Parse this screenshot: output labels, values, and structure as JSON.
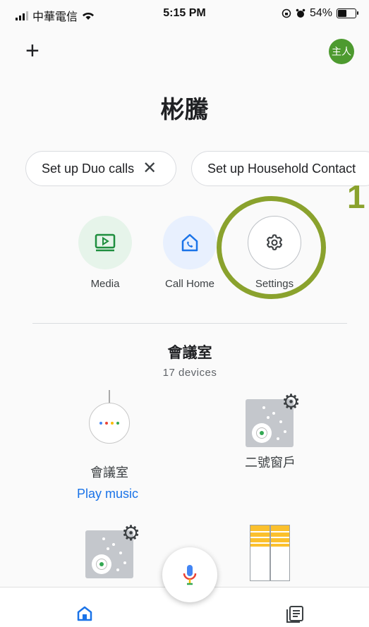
{
  "status_bar": {
    "carrier": "中華電信",
    "time": "5:15 PM",
    "battery_percent": "54%",
    "battery_level": 0.54,
    "icons": [
      "signal-icon",
      "wifi-icon",
      "rotation-lock-icon",
      "alarm-icon",
      "battery-icon"
    ]
  },
  "header": {
    "add_icon": "plus-icon",
    "avatar_text": "主人",
    "avatar_color": "#4d9a2f"
  },
  "home": {
    "name": "彬騰"
  },
  "chips": {
    "duo": {
      "label": "Set up Duo calls",
      "close_icon": "close-icon"
    },
    "household": {
      "label": "Set up Household Contact"
    }
  },
  "actions": [
    {
      "label": "Media",
      "icon": "media-icon"
    },
    {
      "label": "Call Home",
      "icon": "call-home-icon"
    },
    {
      "label": "Settings",
      "icon": "gear-icon"
    }
  ],
  "annotation": {
    "number": "1",
    "color": "#8aa22d"
  },
  "room": {
    "name": "會議室",
    "device_count": "17 devices",
    "devices": [
      {
        "label": "會議室",
        "icon": "smart-speaker-icon"
      },
      {
        "label": "二號窗戶",
        "icon": "smart-plug-icon"
      },
      {
        "label": "",
        "icon": "smart-plug-icon"
      },
      {
        "label": "",
        "icon": "blinds-icon"
      }
    ],
    "play_music": "Play music"
  },
  "bottom_nav": {
    "items": [
      "home-icon",
      "feed-icon"
    ],
    "mic": "mic-icon"
  },
  "colors": {
    "accent_blue": "#1a73e8",
    "google_blue": "#4285f4",
    "google_red": "#ea4335",
    "google_yellow": "#fbbc05",
    "google_green": "#34a853"
  }
}
